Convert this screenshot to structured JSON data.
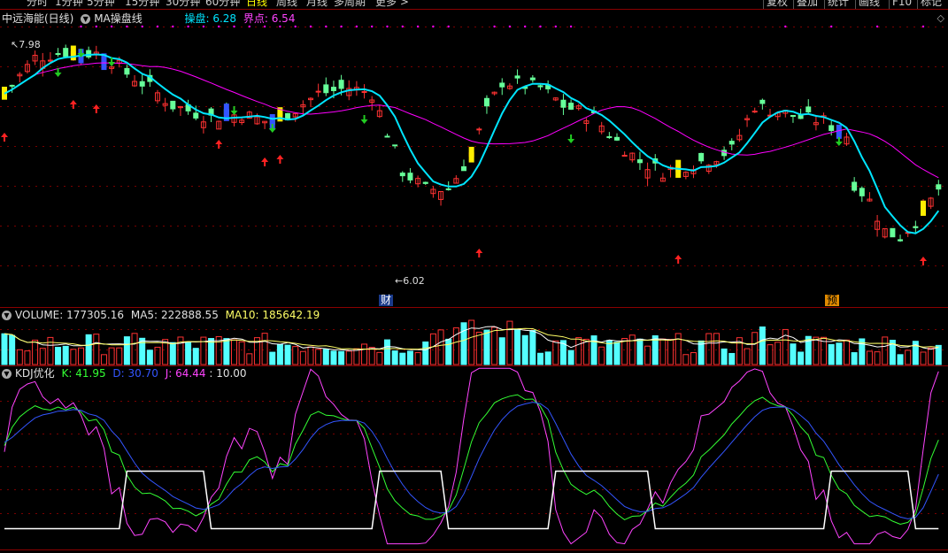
{
  "periods": [
    "分时",
    "1分钟",
    "5分钟",
    "15分钟",
    "30分钟",
    "60分钟",
    "日线",
    "周线",
    "月线",
    "多周期",
    "更多 >"
  ],
  "active_period": "日线",
  "right_buttons": [
    "复权",
    "叠加",
    "统计",
    "画线",
    "F10",
    "标记"
  ],
  "main_header": {
    "stock_name": "中远海能(日线)",
    "indicator_name": "MA操盘线",
    "label1": "操盘:",
    "value1": "6.28",
    "label2": "界点:",
    "value2": "6.54"
  },
  "price_high_label": "7.98",
  "price_low_label": "6.02",
  "markers": {
    "cai": "财",
    "yu": "预"
  },
  "volume_header": {
    "name": "VOLUME:",
    "value": "177305.16",
    "ma5_label": "MA5:",
    "ma5_value": "222888.55",
    "ma10_label": "MA10:",
    "ma10_value": "185642.19"
  },
  "kdj_header": {
    "name": "KDJ优化",
    "k_label": "K:",
    "k_value": "41.95",
    "d_label": "D:",
    "d_value": "30.70",
    "j_label": "J:",
    "j_value": "64.44",
    "extra": ": 10.00"
  },
  "colors": {
    "up": "#ff3232",
    "down": "#54ffff",
    "ma_fast": "#00e5ff",
    "ma_slow": "#ff00ff",
    "k_line": "#33ff33",
    "d_line": "#3355ff",
    "j_line": "#ff44ff",
    "grid": "#7a0000"
  }
}
